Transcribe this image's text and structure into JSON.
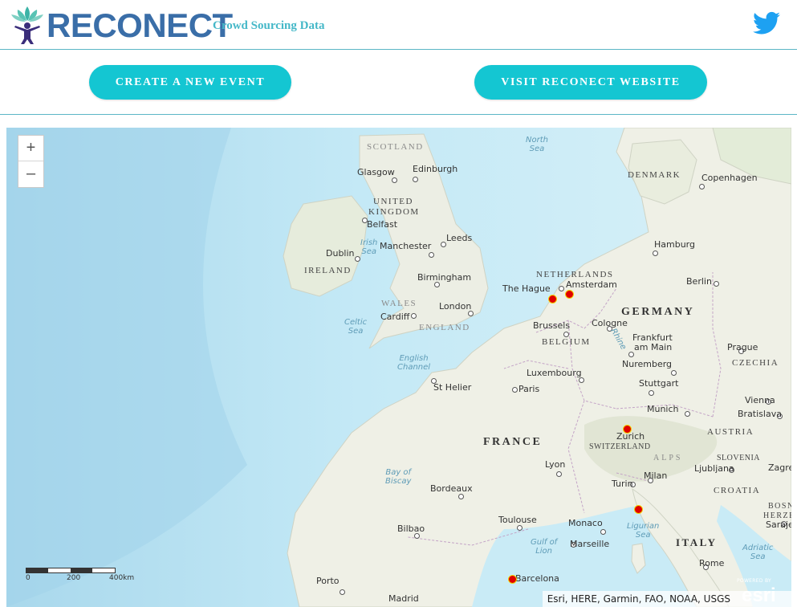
{
  "header": {
    "brand": "RECONECT",
    "tagline": "Crowd Sourcing Data",
    "logo_icon": "lotus-person-icon",
    "social_icon": "twitter-bird-icon",
    "colors": {
      "brand": "#3a6ea8",
      "tagline": "#45b8c8",
      "accent": "#14c6d2",
      "twitter": "#1da1f2"
    }
  },
  "actions": {
    "create_event": "CREATE A NEW EVENT",
    "visit_website": "VISIT RECONECT WEBSITE"
  },
  "map": {
    "zoom_in": "+",
    "zoom_out": "–",
    "countries": {
      "scotland": "SCOTLAND",
      "uk_line1": "UNITED",
      "uk_line2": "KINGDOM",
      "ireland": "IRELAND",
      "wales": "WALES",
      "england": "ENGLAND",
      "netherlands": "NETHERLANDS",
      "belgium": "BELGIUM",
      "germany": "GERMANY",
      "denmark": "DENMARK",
      "france": "FRANCE",
      "switzerland": "SWITZERLAND",
      "austria": "AUSTRIA",
      "czechia": "CZECHIA",
      "slovenia": "SLOVENIA",
      "croatia": "CROATIA",
      "bosnia_line1": "BOSN",
      "bosnia_line2": "HERZE",
      "italy": "ITALY",
      "alps": "ALPS"
    },
    "waters": {
      "north_sea_line1": "North",
      "north_sea_line2": "Sea",
      "irish_sea_line1": "Irish",
      "irish_sea_line2": "Sea",
      "celtic_sea_line1": "Celtic",
      "celtic_sea_line2": "Sea",
      "english_channel_line1": "English",
      "english_channel_line2": "Channel",
      "bay_biscay_line1": "Bay of",
      "bay_biscay_line2": "Biscay",
      "gulf_lion_line1": "Gulf of",
      "gulf_lion_line2": "Lion",
      "ligurian_line1": "Ligurian",
      "ligurian_line2": "Sea",
      "adriatic_line1": "Adriatic",
      "adriatic_line2": "Sea"
    },
    "cities": {
      "glasgow": "Glasgow",
      "edinburgh": "Edinburgh",
      "belfast": "Belfast",
      "dublin": "Dublin",
      "manchester": "Manchester",
      "leeds": "Leeds",
      "birmingham": "Birmingham",
      "london": "London",
      "cardiff": "Cardiff",
      "the_hague": "The Hague",
      "amsterdam": "Amsterdam",
      "brussels": "Brussels",
      "cologne": "Cologne",
      "rhine": "Rhine",
      "frankfurt_line1": "Frankfurt",
      "frankfurt_line2": "am Main",
      "luxembourg": "Luxembourg",
      "nuremberg": "Nuremberg",
      "stuttgart": "Stuttgart",
      "st_helier": "St Helier",
      "paris": "Paris",
      "munich": "Munich",
      "zurich": "Zurich",
      "hamburg": "Hamburg",
      "copenhagen": "Copenhagen",
      "berlin": "Berlin",
      "prague": "Prague",
      "vienna": "Vienna",
      "bratislava": "Bratislava",
      "ljubljana": "Ljubljana",
      "zagreb": "Zagre",
      "sarajevo": "Saraje",
      "lyon": "Lyon",
      "bordeaux": "Bordeaux",
      "turin": "Turin",
      "milan": "Milan",
      "toulouse": "Toulouse",
      "monaco": "Monaco",
      "marseille": "Marseille",
      "bilbao": "Bilbao",
      "rome": "Rome",
      "porto": "Porto",
      "barcelona": "Barcelona",
      "madrid": "Madrid"
    },
    "scale": {
      "zero": "0",
      "mid": "200",
      "end": "400km"
    },
    "attribution": "Esri, HERE, Garmin, FAO, NOAA, USGS",
    "esri_powered": "POWERED BY",
    "esri_logo": "esri",
    "event_markers": [
      "The Hague event",
      "Amsterdam event",
      "Zurich event",
      "Genoa event",
      "Barcelona event"
    ]
  }
}
